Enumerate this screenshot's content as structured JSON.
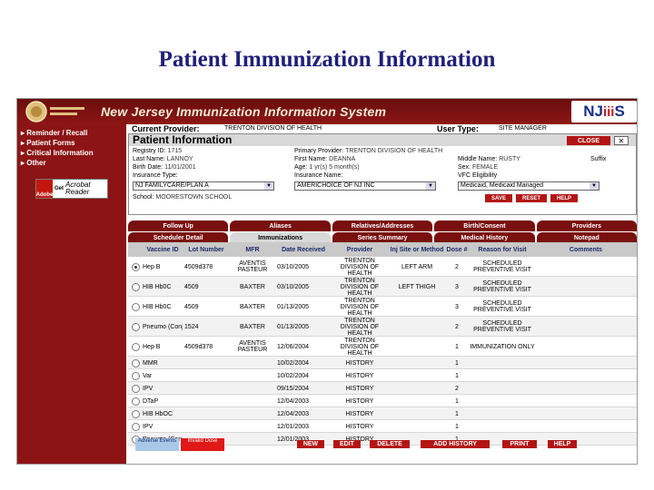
{
  "slide": {
    "title": "Patient Immunization Information"
  },
  "app": {
    "banner_title": "New Jersey Immunization Information System",
    "logo_text": "NJ",
    "logo_suffix": "S",
    "logo_figures": "iii"
  },
  "sidebar": {
    "items": [
      {
        "label": "▸ Reminder / Recall"
      },
      {
        "label": "▸ Patient Forms"
      },
      {
        "label": "▸ Critical Information"
      },
      {
        "label": "▸ Other"
      }
    ],
    "acrobat": {
      "brand": "Adobe",
      "get": "Get",
      "line1": "Acrobat",
      "line2": "Reader"
    }
  },
  "provider_bar": {
    "current_provider_label": "Current Provider:",
    "current_provider_value": "TRENTON DIVISION OF HEALTH",
    "user_type_label": "User Type:",
    "user_type_value": "SITE MANAGER"
  },
  "patient_info": {
    "title": "Patient Information",
    "close_label": "CLOSE",
    "x_label": "✕",
    "fields": {
      "registry_id_label": "Registry ID:",
      "registry_id_value": "1715",
      "last_name_label": "Last Name:",
      "last_name_value": "LANNOY",
      "birth_date_label": "Birth Date:",
      "birth_date_value": "11/01/2001",
      "insurance_type_label": "Insurance Type:",
      "primary_provider_label": "Primary Provider:",
      "primary_provider_value": "TRENTON DIVISION OF HEALTH",
      "first_name_label": "First Name:",
      "first_name_value": "DEANNA",
      "age_label": "Age:",
      "age_value": "1 yr(s) 5 month(s)",
      "insurance_name_label": "Insurance Name:",
      "middle_name_label": "Middle Name:",
      "middle_name_value": "RUSTY",
      "suffix_label": "Suffix",
      "sex_label": "Sex:",
      "sex_value": "FEMALE",
      "vfc_label": "VFC Eligibility",
      "school_label": "School:",
      "school_value": "MOORESTOWN SCHOOL"
    },
    "insurance_type_selected": "NJ FAMILYCARE/PLAN A",
    "insurance_name_selected": "AMERICHOICE OF NJ INC",
    "vfc_selected": "Medicaid, Medicaid Managed",
    "buttons": {
      "save": "SAVE",
      "reset": "RESET",
      "help": "HELP"
    }
  },
  "tabs_row1": [
    {
      "label": "Follow Up"
    },
    {
      "label": "Aliases"
    },
    {
      "label": "Relatives/Addresses"
    },
    {
      "label": "Birth/Consent"
    },
    {
      "label": "Providers"
    }
  ],
  "tabs_row2": [
    {
      "label": "Scheduler Detail"
    },
    {
      "label": "Immunizations"
    },
    {
      "label": "Series Summary"
    },
    {
      "label": "Medical History"
    },
    {
      "label": "Notepad"
    }
  ],
  "table": {
    "headers": {
      "vaccine": "Vaccine ID",
      "lot": "Lot Number",
      "mfr": "MFR",
      "date": "Date Received",
      "provider": "Provider",
      "inj": "Inj Site or Method",
      "dose": "Dose #",
      "reason": "Reason for Visit",
      "comments": "Comments"
    },
    "rows": [
      {
        "vaccine": "Hep B",
        "lot": "4509d378",
        "mfr": "AVENTIS PASTEUR",
        "date": "03/10/2005",
        "provider": "TRENTON DIVISION OF HEALTH",
        "inj": "LEFT ARM",
        "dose": "2",
        "reason": "SCHEDULED PREVENTIVE VISIT",
        "comments": ""
      },
      {
        "vaccine": "HIB Hb0C",
        "lot": "4509",
        "mfr": "BAXTER",
        "date": "03/10/2005",
        "provider": "TRENTON DIVISION OF HEALTH",
        "inj": "LEFT THIGH",
        "dose": "3",
        "reason": "SCHEDULED PREVENTIVE VISIT",
        "comments": ""
      },
      {
        "vaccine": "HIB Hb0C",
        "lot": "4509",
        "mfr": "BAXTER",
        "date": "01/13/2005",
        "provider": "TRENTON DIVISION OF HEALTH",
        "inj": "",
        "dose": "3",
        "reason": "SCHEDULED PREVENTIVE VISIT",
        "comments": ""
      },
      {
        "vaccine": "Pneumo (Conj)",
        "lot": "1524",
        "mfr": "BAXTER",
        "date": "01/13/2005",
        "provider": "TRENTON DIVISION OF HEALTH",
        "inj": "",
        "dose": "2",
        "reason": "SCHEDULED PREVENTIVE VISIT",
        "comments": ""
      },
      {
        "vaccine": "Hep B",
        "lot": "4509d378",
        "mfr": "AVENTIS PASTEUR",
        "date": "12/06/2004",
        "provider": "TRENTON DIVISION OF HEALTH",
        "inj": "",
        "dose": "1",
        "reason": "IMMUNIZATION ONLY",
        "comments": ""
      },
      {
        "vaccine": "MMR",
        "lot": "",
        "mfr": "",
        "date": "10/02/2004",
        "provider": "HISTORY",
        "inj": "",
        "dose": "1",
        "reason": "",
        "comments": ""
      },
      {
        "vaccine": "Var",
        "lot": "",
        "mfr": "",
        "date": "10/02/2004",
        "provider": "HISTORY",
        "inj": "",
        "dose": "1",
        "reason": "",
        "comments": ""
      },
      {
        "vaccine": "IPV",
        "lot": "",
        "mfr": "",
        "date": "09/15/2004",
        "provider": "HISTORY",
        "inj": "",
        "dose": "2",
        "reason": "",
        "comments": ""
      },
      {
        "vaccine": "DTaP",
        "lot": "",
        "mfr": "",
        "date": "12/04/2003",
        "provider": "HISTORY",
        "inj": "",
        "dose": "1",
        "reason": "",
        "comments": ""
      },
      {
        "vaccine": "HIB HbOC",
        "lot": "",
        "mfr": "",
        "date": "12/04/2003",
        "provider": "HISTORY",
        "inj": "",
        "dose": "1",
        "reason": "",
        "comments": ""
      },
      {
        "vaccine": "IPV",
        "lot": "",
        "mfr": "",
        "date": "12/01/2003",
        "provider": "HISTORY",
        "inj": "",
        "dose": "1",
        "reason": "",
        "comments": ""
      },
      {
        "vaccine": "Pneumo (Conj)",
        "lot": "",
        "mfr": "",
        "date": "12/01/2003",
        "provider": "HISTORY",
        "inj": "",
        "dose": "1",
        "reason": "",
        "comments": ""
      }
    ]
  },
  "bottom": {
    "legend_adverse": "Adverse Events",
    "legend_invalid": "Invalid Dose",
    "buttons": {
      "new": "NEW",
      "edit": "EDIT",
      "delete": "DELETE",
      "add_history": "ADD HISTORY",
      "print": "PRINT",
      "help": "HELP"
    }
  },
  "colors": {
    "brand_red": "#8c1414",
    "button_red": "#b31515",
    "header_blue": "#1b2a6b"
  }
}
